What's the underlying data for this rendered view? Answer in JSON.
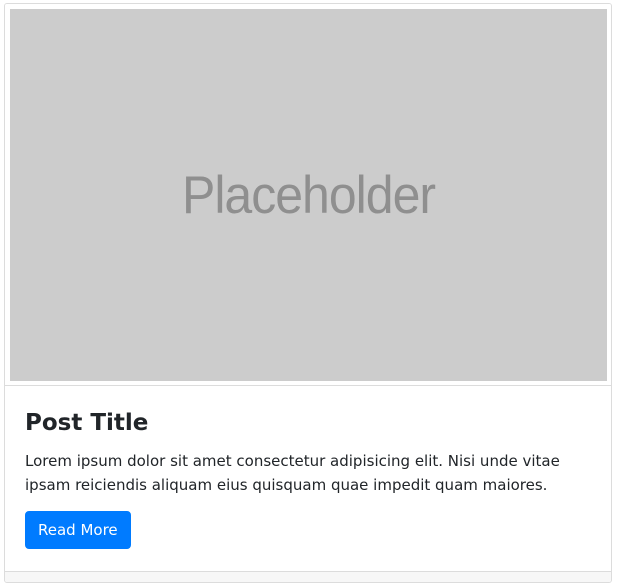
{
  "card": {
    "image_placeholder_text": "Placeholder",
    "title": "Post Title",
    "text": "Lorem ipsum dolor sit amet consectetur adipisicing elit. Nisi unde vitae ipsam reiciendis aliquam eius quisquam quae impedit quam maiores.",
    "button_label": "Read More"
  },
  "colors": {
    "primary": "#007bff",
    "placeholder_bg": "#cccccc",
    "placeholder_text": "#8f8f8f"
  }
}
